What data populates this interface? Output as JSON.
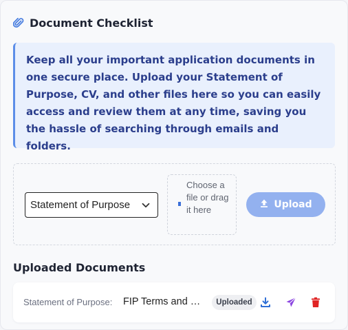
{
  "header": {
    "title": "Document Checklist",
    "icon": "paperclip-icon"
  },
  "info": {
    "text": "Keep all your important application documents in one secure place. Upload your Statement of Purpose, CV, and other files here so you can easily access and review them at any time, saving you the hassle of searching through emails and folders."
  },
  "upload": {
    "document_type_selected": "Statement of Purpose",
    "dropzone_text": "Choose a file or drag it here",
    "button_label": "Upload",
    "button_icon": "upload-icon"
  },
  "uploaded": {
    "title": "Uploaded Documents",
    "items": [
      {
        "type_label": "Statement of Purpose:",
        "file_name": "FIP Terms and Conditions",
        "status": "Uploaded",
        "actions": [
          "download-icon",
          "send-icon",
          "trash-icon"
        ]
      }
    ]
  },
  "colors": {
    "accent": "#5b8de8",
    "info_bg": "#e9f0fd",
    "info_text": "#2b3e8c",
    "upload_button": "#93b1ef",
    "download": "#2f6fd6",
    "send": "#8b45e0",
    "delete": "#e02424"
  }
}
